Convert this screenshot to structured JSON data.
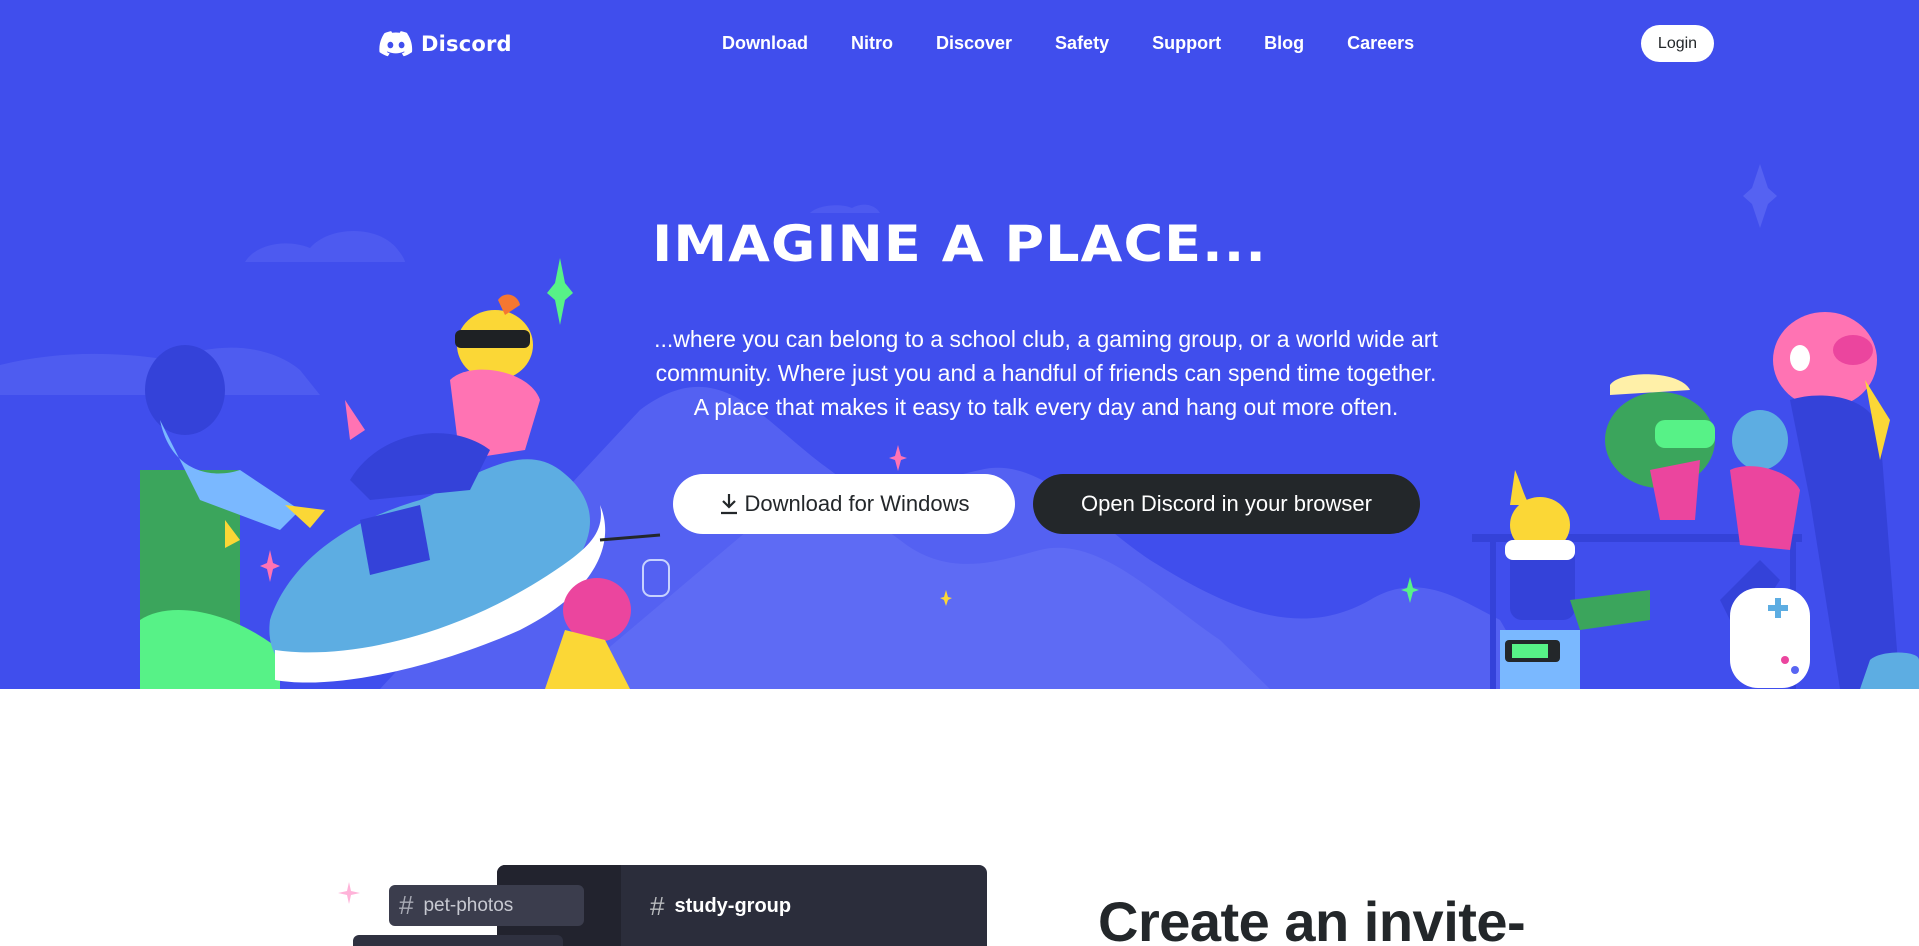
{
  "nav": {
    "logo_text": "Discord",
    "links": [
      "Download",
      "Nitro",
      "Discover",
      "Safety",
      "Support",
      "Blog",
      "Careers"
    ],
    "login_label": "Login"
  },
  "hero": {
    "title": "IMAGINE A PLACE...",
    "copy_lines": [
      "...where you can belong to a school club, a gaming group, or a world wide art",
      "community. Where just you and a handful of friends can spend time together.",
      "A place that makes it easy to talk every day and hang out more often."
    ],
    "download_label": "Download for Windows",
    "browser_label": "Open Discord in your browser"
  },
  "section": {
    "channel_main": "study-group",
    "channel_pet": "pet-photos",
    "hash_symbol": "#",
    "title": "Create an invite-"
  },
  "colors": {
    "blurple": "#404eed",
    "dark": "#23272a",
    "white": "#ffffff"
  }
}
